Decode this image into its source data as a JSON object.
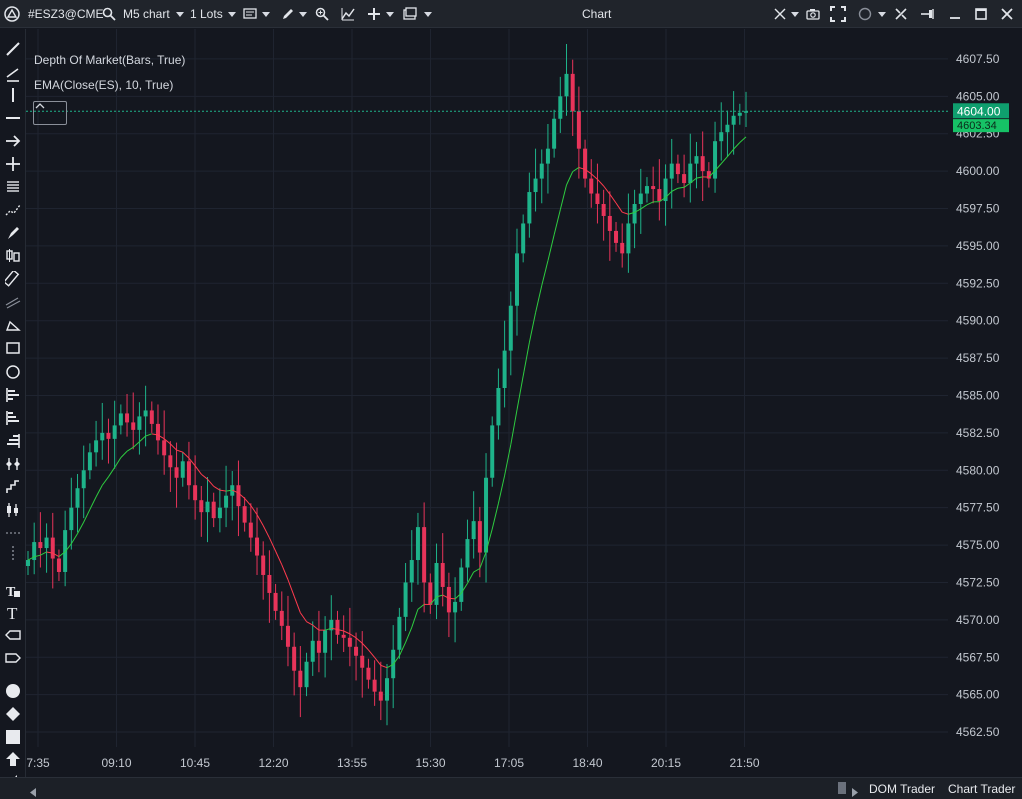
{
  "titlebar": {
    "symbol": "#ESZ3@CME",
    "chart_type": "M5 chart",
    "lots": "1 Lots",
    "window_title": "Chart"
  },
  "indicators": [
    {
      "label": "Depth Of Market(Bars, True)"
    },
    {
      "label": "EMA(Close(ES), 10, True)"
    }
  ],
  "price_axis": {
    "labels": [
      "4607.50",
      "4605.00",
      "4602.50",
      "4600.00",
      "4597.50",
      "4595.00",
      "4592.50",
      "4590.00",
      "4587.50",
      "4585.00",
      "4582.50",
      "4580.00",
      "4577.50",
      "4575.00",
      "4572.50",
      "4570.00",
      "4567.50",
      "4565.00",
      "4562.50"
    ],
    "last_price": "4604.00",
    "ema_price": "4603.34"
  },
  "time_axis": {
    "labels": [
      "7:35",
      "09:10",
      "10:45",
      "12:20",
      "13:55",
      "15:30",
      "17:05",
      "18:40",
      "20:15",
      "21:50"
    ]
  },
  "bottom_tabs": {
    "dom_trader": "DOM Trader",
    "chart_trader": "Chart Trader"
  },
  "colors": {
    "background": "#14171f",
    "bull": "#1eb38a",
    "bear": "#e8345a",
    "ema_up": "#2ecc40",
    "ema_down": "#ff3b4e",
    "last_price_tag": "#0f9f6e"
  },
  "chart_data": {
    "type": "candlestick",
    "series": [
      {
        "name": "ESZ3 M5",
        "closes": [
          4574.0,
          4575.2,
          4574.8,
          4575.5,
          4574.1,
          4573.2,
          4576.0,
          4577.5,
          4578.8,
          4580.0,
          4581.2,
          4582.0,
          4582.5,
          4582.1,
          4583.0,
          4583.8,
          4583.2,
          4582.7,
          4583.6,
          4584.0,
          4583.1,
          4582.0,
          4581.0,
          4580.2,
          4579.5,
          4580.6,
          4579.0,
          4578.0,
          4577.2,
          4577.9,
          4576.8,
          4577.5,
          4578.3,
          4579.0,
          4577.6,
          4576.5,
          4575.5,
          4574.3,
          4573.0,
          4571.8,
          4570.6,
          4569.6,
          4568.2,
          4566.6,
          4565.5,
          4567.2,
          4568.6,
          4567.8,
          4569.3,
          4570.0,
          4569.0,
          4568.8,
          4568.2,
          4567.6,
          4566.8,
          4566.0,
          4565.2,
          4564.6,
          4566.1,
          4568.0,
          4570.2,
          4572.5,
          4574.0,
          4576.2,
          4572.5,
          4571.0,
          4573.8,
          4572.2,
          4570.5,
          4571.2,
          4573.5,
          4575.4,
          4576.6,
          4574.5,
          4579.5,
          4583.0,
          4585.5,
          4588.0,
          4591.0,
          4594.5,
          4596.5,
          4598.6,
          4599.5,
          4600.5,
          4601.5,
          4603.5,
          4605.0,
          4606.5,
          4604.0,
          4601.5,
          4599.5,
          4598.5,
          4597.8,
          4597.0,
          4596.0,
          4595.2,
          4594.5,
          4596.5,
          4597.8,
          4598.5,
          4599.0,
          4598.8,
          4598.0,
          4599.5,
          4600.5,
          4599.8,
          4599.2,
          4600.5,
          4601.0,
          4600.0,
          4599.5,
          4602.0,
          4602.6,
          4603.1,
          4603.7,
          4603.9,
          4604.0
        ]
      }
    ],
    "ema": {
      "name": "EMA(Close(ES), 10, True)",
      "period": 10
    },
    "y_range": [
      4561.5,
      4609.5
    ],
    "x_ticks": [
      "7:35",
      "09:10",
      "10:45",
      "12:20",
      "13:55",
      "15:30",
      "17:05",
      "18:40",
      "20:15",
      "21:50"
    ],
    "grid": true
  }
}
